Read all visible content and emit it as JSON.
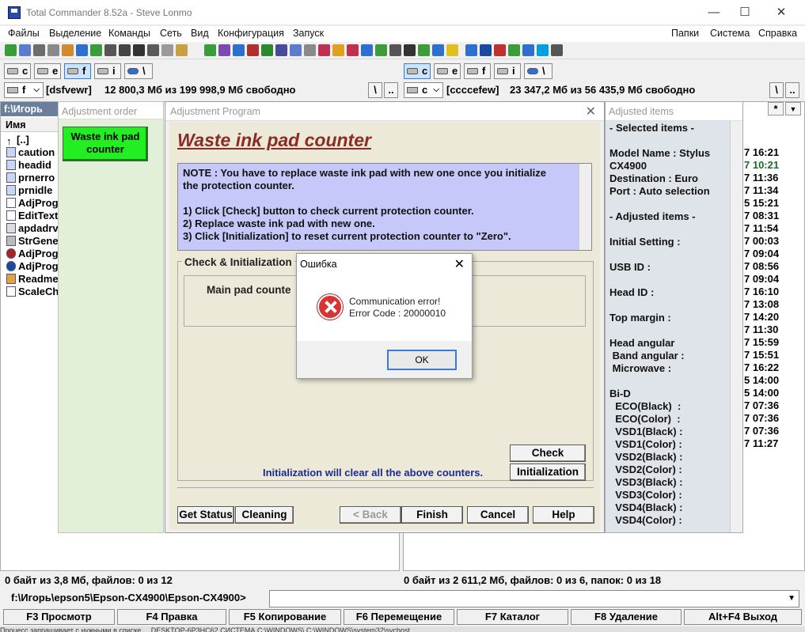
{
  "window": {
    "title": "Total Commander 8.52a - Steve Lonmo"
  },
  "menu": {
    "items": [
      "Файлы",
      "Выделение",
      "Команды",
      "Сеть",
      "Вид",
      "Конфигурация",
      "Запуск"
    ],
    "right_items": [
      "Папки",
      "Система",
      "Справка"
    ]
  },
  "drives_left": [
    "c",
    "e",
    "f",
    "i",
    "\\"
  ],
  "drives_right": [
    "c",
    "e",
    "f",
    "i",
    "\\"
  ],
  "left_drive": {
    "letter": "f",
    "label": "[dsfvewr]",
    "info": "12 800,3 Мб из 199 998,9 Мб свободно"
  },
  "right_drive": {
    "letter": "c",
    "label": "[ccccefew]",
    "info": "23 347,2 Мб из 56 435,9 Мб свободно"
  },
  "nav_buttons": {
    "root": "\\",
    "up": ".."
  },
  "left_panel": {
    "path": "f:\\Игорь",
    "column_name": "Имя",
    "files": [
      "[..]",
      "caution",
      "headid",
      "prnerro",
      "prnidle",
      "AdjProg",
      "EditText",
      "apdadrv",
      "StrGene",
      "AdjProg",
      "AdjProg",
      "Readme",
      "ScaleCh"
    ]
  },
  "right_panel": {
    "times": [
      "7 16:21",
      "7 10:21",
      "7 11:36",
      "7 11:34",
      "5 15:21",
      "7 08:31",
      "7 11:54",
      "7 00:03",
      "7 09:04",
      "7 08:56",
      "7 09:04",
      "7 16:10",
      "7 13:08",
      "7 14:20",
      "7 11:30",
      "7 15:59",
      "7 15:51",
      "7 16:22",
      "5 14:00",
      "5 14:00",
      "7 07:36",
      "7 07:36",
      "7 07:36",
      "7 11:27"
    ],
    "star": "*"
  },
  "adj_order": {
    "header": "Adjustment order",
    "item": "Waste ink pad counter"
  },
  "adj_program": {
    "header": "Adjustment Program",
    "title": "Waste ink pad counter",
    "note_lines": [
      "NOTE : You have to replace waste ink pad with new one once you initialize",
      "the protection counter.",
      "",
      "1) Click [Check] button to check current protection counter.",
      "2) Replace waste ink pad with new one.",
      "3) Click [Initialization] to reset current protection counter to \"Zero\"."
    ],
    "group_label": "Check & Initialization",
    "main_pad_label": "Main pad counte",
    "check_button": "Check",
    "init_button": "Initialization",
    "init_note": "Initialization will clear all the above counters.",
    "buttons": {
      "get_status": "Get Status",
      "cleaning": "Cleaning",
      "back": "< Back",
      "finish": "Finish",
      "cancel": "Cancel",
      "help": "Help"
    }
  },
  "adj_items": {
    "header": "Adjusted items",
    "lines": [
      "- Selected items -",
      "",
      "Model Name : Stylus",
      "CX4900",
      "Destination : Euro",
      "Port : Auto selection",
      "",
      "- Adjusted items -",
      "",
      "Initial Setting :",
      "",
      "USB ID :",
      "",
      "Head ID :",
      "",
      "Top margin :",
      "",
      "Head angular",
      " Band angular :",
      " Microwave :",
      "",
      "Bi-D",
      "  ECO(Black)  :",
      "  ECO(Color)  :",
      "  VSD1(Black) :",
      "  VSD1(Color) :",
      "  VSD2(Black) :",
      "  VSD2(Color) :",
      "  VSD3(Black) :",
      "  VSD3(Color) :",
      "  VSD4(Black) :",
      "  VSD4(Color) :"
    ]
  },
  "error_dialog": {
    "title": "Ошибка",
    "line1": "Communication error!",
    "line2": "Error Code : 20000010",
    "ok": "OK"
  },
  "status": {
    "left": "0 байт из 3,8 Мб, файлов: 0 из 12",
    "right": "0 байт из 2 611,2 Мб, файлов: 0 из 6, папок: 0 из 18"
  },
  "cmdline": {
    "path": "f:\\Игорь\\epson5\\Epson-CX4900\\Epson-CX4900>"
  },
  "fkeys": [
    "F3 Просмотр",
    "F4 Правка",
    "F5 Копирование",
    "F6 Перемещение",
    "F7 Каталог",
    "F8 Удаление",
    "Alt+F4 Выход"
  ],
  "taskstrip": "Процесс запрашивает с нужными в списке ...   DESKTOP-6P3HC62        СИСТЕМА      C:\\WINDOWS\\         C:\\WINDOWS\\system32\\svchost"
}
